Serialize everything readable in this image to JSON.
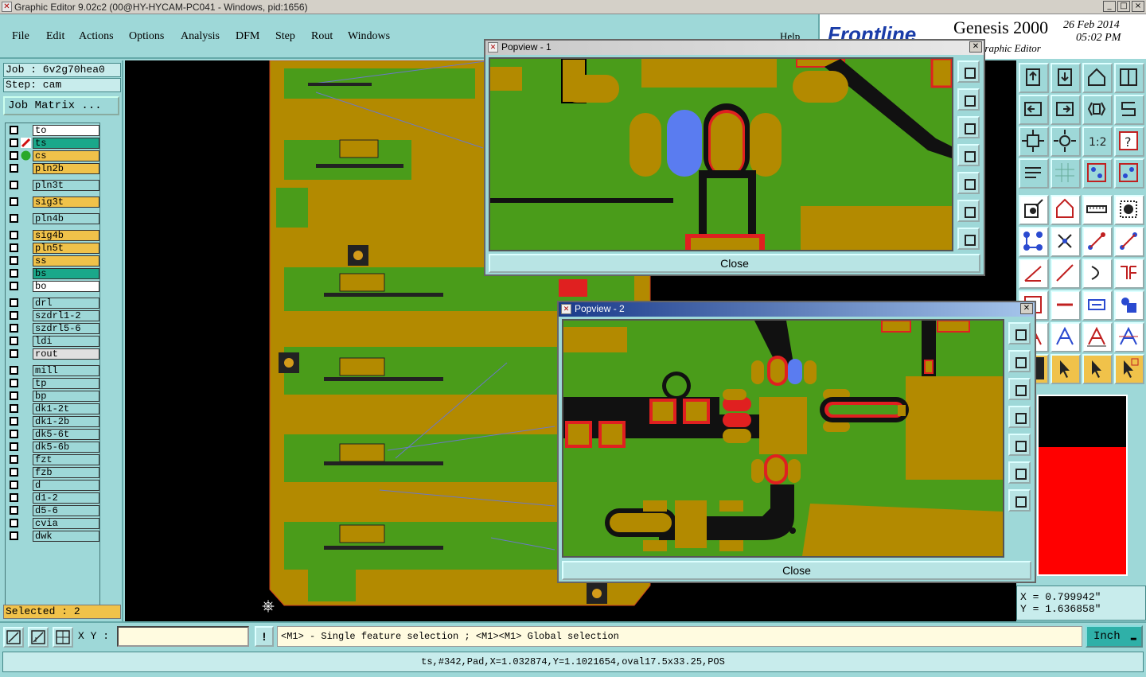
{
  "window": {
    "title": "Graphic Editor 9.02c2 (00@HY-HYCAM-PC041 - Windows, pid:1656)",
    "buttons": [
      "_",
      "□",
      "×"
    ]
  },
  "menu": {
    "items": [
      "File",
      "Edit",
      "Actions",
      "Options",
      "Analysis",
      "DFM",
      "Step",
      "Rout",
      "Windows"
    ],
    "help": "Help"
  },
  "brand": {
    "logo": "Frontline",
    "product": "Genesis 2000",
    "date": "26 Feb 2014",
    "time": "05:02 PM",
    "subtitle": "Graphic Editor"
  },
  "job": {
    "job_label": "Job : 6v2g70hea0",
    "step_label": "Step: cam",
    "matrix_button": "Job Matrix ..."
  },
  "layers": [
    {
      "name": "to",
      "color": "#ffffff"
    },
    {
      "name": "ts",
      "color": "#1aa88a"
    },
    {
      "name": "cs",
      "color": "#f0c24a"
    },
    {
      "name": "pln2b",
      "color": "#f0c24a"
    },
    {
      "name": "pln3t",
      "color": "#9ed8d8"
    },
    {
      "name": "sig3t",
      "color": "#f0c24a"
    },
    {
      "name": "pln4b",
      "color": "#9ed8d8"
    },
    {
      "name": "sig4b",
      "color": "#f0c24a"
    },
    {
      "name": "pln5t",
      "color": "#f0c24a"
    },
    {
      "name": "ss",
      "color": "#f0c24a"
    },
    {
      "name": "bs",
      "color": "#1aa88a"
    },
    {
      "name": "bo",
      "color": "#ffffff"
    },
    {
      "name": "drl",
      "color": "#9ed8d8"
    },
    {
      "name": "szdrl1-2",
      "color": "#9ed8d8"
    },
    {
      "name": "szdrl5-6",
      "color": "#9ed8d8"
    },
    {
      "name": "ldi",
      "color": "#9ed8d8"
    },
    {
      "name": "rout",
      "color": "#e0e0e0"
    },
    {
      "name": "mill",
      "color": "#9ed8d8"
    },
    {
      "name": "tp",
      "color": "#9ed8d8"
    },
    {
      "name": "bp",
      "color": "#9ed8d8"
    },
    {
      "name": "dk1-2t",
      "color": "#9ed8d8"
    },
    {
      "name": "dk1-2b",
      "color": "#9ed8d8"
    },
    {
      "name": "dk5-6t",
      "color": "#9ed8d8"
    },
    {
      "name": "dk5-6b",
      "color": "#9ed8d8"
    },
    {
      "name": "fzt",
      "color": "#9ed8d8"
    },
    {
      "name": "fzb",
      "color": "#9ed8d8"
    },
    {
      "name": "d",
      "color": "#9ed8d8"
    },
    {
      "name": "d1-2",
      "color": "#9ed8d8"
    },
    {
      "name": "d5-6",
      "color": "#9ed8d8"
    },
    {
      "name": "cvia",
      "color": "#9ed8d8"
    },
    {
      "name": "dwk",
      "color": "#9ed8d8"
    }
  ],
  "selected": "Selected : 2",
  "popview1": {
    "title": "Popview - 1",
    "close": "Close"
  },
  "popview2": {
    "title": "Popview - 2",
    "close": "Close"
  },
  "coords": {
    "x": "X = 0.799942\"",
    "y": "Y = 1.636858\""
  },
  "bottom": {
    "xy_label": "X Y :",
    "xy_value": "",
    "exclaim": "!",
    "hint": "<M1> - Single feature selection ; <M1><M1> Global selection",
    "unit": "Inch"
  },
  "status": "ts,#342,Pad,X=1.032874,Y=1.1021654,oval17.5x33.25,POS"
}
